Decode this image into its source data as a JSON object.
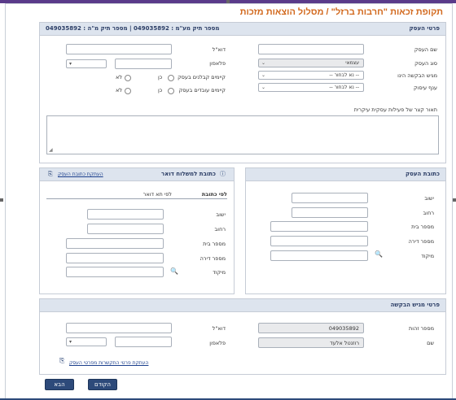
{
  "page": {
    "title": "תקופת זכאות \"חרבות ברזל\" / מסלול הוצאות מזכות"
  },
  "business": {
    "header": "פרטי העסק",
    "file_numbers": "מספר תיק מע\"מ : 049035892 | מספר תיק מ\"ה : 049035892",
    "labels": {
      "name": "שם העסק",
      "type": "סוג העסק",
      "applicant": "מגיש הבקשה הינו",
      "industry": "ענף עיסוק",
      "email": "דוא\"ל",
      "phone": "פלאפון",
      "contractors": "קיימים קבלנים בעסק",
      "employees": "קיימים עובדים בעסק",
      "description": "תאור קצר של פעילות עסקית עיקרית"
    },
    "values": {
      "type": "עצמאי",
      "applicant_select": "-- נא לבחור --",
      "industry_select": "-- נא לבחור --",
      "phone_prefix": ""
    },
    "radio": {
      "yes": "כן",
      "no": "לא"
    }
  },
  "business_address": {
    "header": "כתובת העסק",
    "labels": {
      "city": "ישוב",
      "street": "רחוב",
      "house": "מספר בית",
      "apt": "מספר דירה",
      "zip": "מיקוד"
    }
  },
  "mailing": {
    "header": "כתובת למשלוח דואר",
    "copy_link": "העתקת כתובת העסק",
    "tabs": {
      "by_address": "לפי כתובת",
      "by_pobox": "לפי תא דואר"
    },
    "labels": {
      "city": "ישוב",
      "street": "רחוב",
      "house": "מספר בית",
      "apt": "מספר דירה",
      "zip": "מיקוד"
    }
  },
  "applicant": {
    "header": "פרטי מגיש הבקשה",
    "labels": {
      "id": "מספר זהות",
      "name": "שם",
      "email": "דוא\"ל",
      "phone": "פלאפון"
    },
    "values": {
      "id": "049035892",
      "name": "רוזנטל אלעד"
    },
    "copy_link": "העתקת פרטי התקשרות מפרטי העסק"
  },
  "buttons": {
    "back": "הקודם",
    "next": "הבא"
  }
}
